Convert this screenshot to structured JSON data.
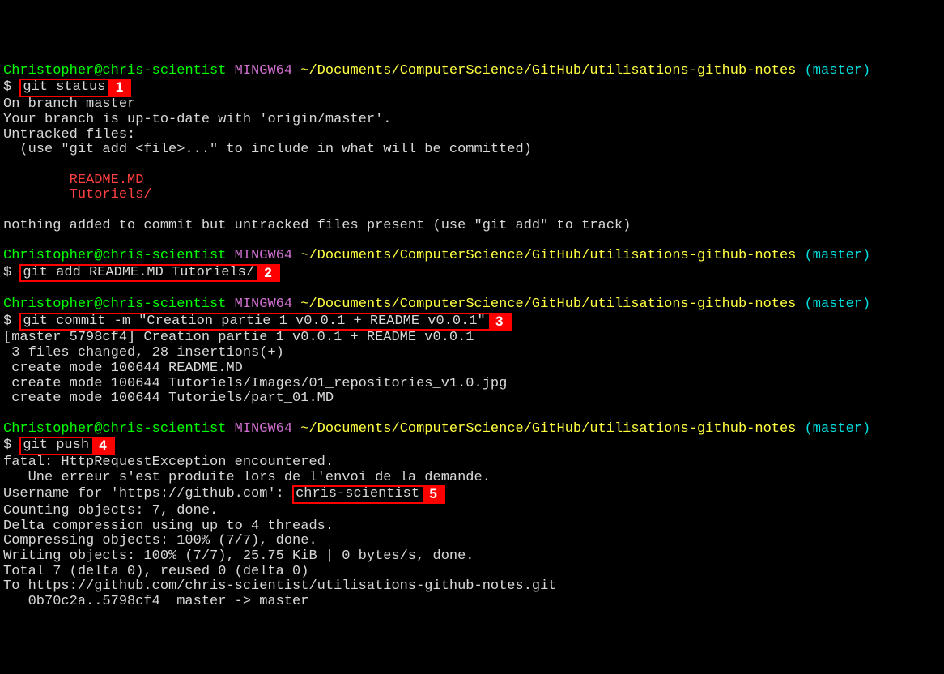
{
  "prompts": {
    "user": "Christopher",
    "host": "chris-scientist",
    "shell": "MINGW64",
    "path": "~/Documents/ComputerScience/GitHub/utilisations-github-notes",
    "branch": "(master)",
    "dollar": "$"
  },
  "step1": {
    "cmd": "git status",
    "badge": "1",
    "out": {
      "l1": "On branch master",
      "l2": "Your branch is up-to-date with 'origin/master'.",
      "l3": "Untracked files:",
      "l4": "  (use \"git add <file>...\" to include in what will be committed)",
      "f1": "        README.MD",
      "f2": "        Tutoriels/",
      "l5": "nothing added to commit but untracked files present (use \"git add\" to track)"
    }
  },
  "step2": {
    "cmd": "git add README.MD Tutoriels/",
    "badge": "2"
  },
  "step3": {
    "cmd": "git commit -m \"Creation partie 1 v0.0.1 + README v0.0.1\"",
    "badge": "3",
    "out": {
      "l1": "[master 5798cf4] Creation partie 1 v0.0.1 + README v0.0.1",
      "l2": " 3 files changed, 28 insertions(+)",
      "l3": " create mode 100644 README.MD",
      "l4": " create mode 100644 Tutoriels/Images/01_repositories_v1.0.jpg",
      "l5": " create mode 100644 Tutoriels/part_01.MD"
    }
  },
  "step4": {
    "cmd": "git push",
    "badge": "4",
    "out": {
      "l1": "fatal: HttpRequestException encountered.",
      "l2": "   Une erreur s'est produite lors de l'envoi de la demande.",
      "userprompt": "Username for 'https://github.com': ",
      "username": "chris-scientist",
      "badge5": "5",
      "l3": "Counting objects: 7, done.",
      "l4": "Delta compression using up to 4 threads.",
      "l5": "Compressing objects: 100% (7/7), done.",
      "l6": "Writing objects: 100% (7/7), 25.75 KiB | 0 bytes/s, done.",
      "l7": "Total 7 (delta 0), reused 0 (delta 0)",
      "l8": "To https://github.com/chris-scientist/utilisations-github-notes.git",
      "l9": "   0b70c2a..5798cf4  master -> master"
    }
  }
}
